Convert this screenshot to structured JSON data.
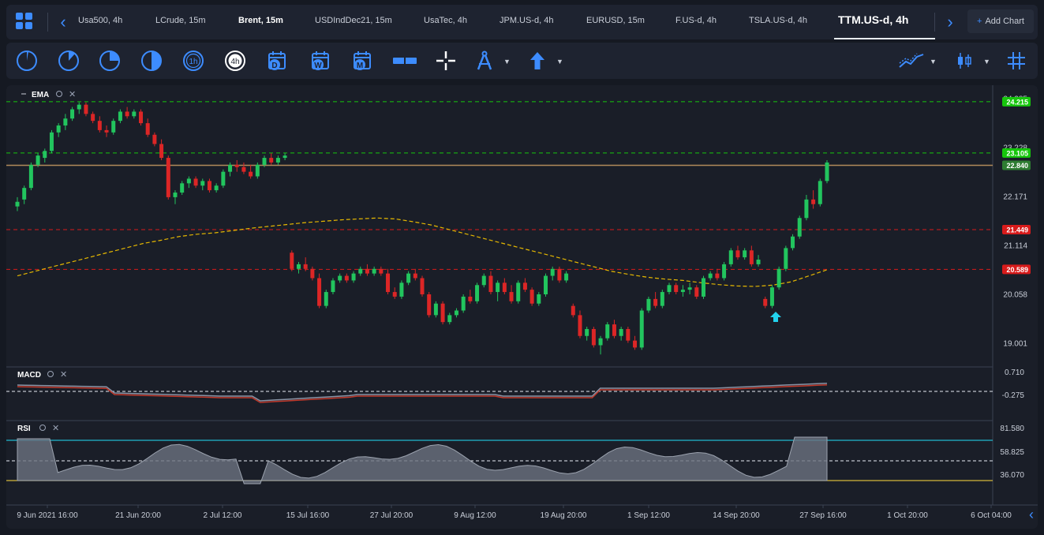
{
  "tabs": {
    "items": [
      {
        "label": "Usa500, 4h"
      },
      {
        "label": "LCrude, 15m"
      },
      {
        "label": "Brent, 15m"
      },
      {
        "label": "USDIndDec21, 15m"
      },
      {
        "label": "UsaTec, 4h"
      },
      {
        "label": "JPM.US-d, 4h"
      },
      {
        "label": "EURUSD, 15m"
      },
      {
        "label": "F.US-d, 4h"
      },
      {
        "label": "TSLA.US-d, 4h"
      },
      {
        "label": "TTM.US-d, 4h"
      }
    ],
    "active_index": 9,
    "add_chart_label": "Add Chart"
  },
  "toolbar": {
    "timeframes": [
      {
        "icon": "1m-timeframe-icon"
      },
      {
        "icon": "15m-timeframe-icon"
      },
      {
        "icon": "30m-timeframe-icon"
      },
      {
        "icon": "2h-timeframe-icon"
      },
      {
        "label": "1h"
      },
      {
        "label": "4h",
        "active": true
      },
      {
        "label": "D"
      },
      {
        "label": "W"
      },
      {
        "label": "M"
      }
    ],
    "tools": [
      "horizontal-line-icon",
      "crosshair-icon",
      "drawing-compass-icon",
      "arrow-up-icon"
    ],
    "right_tools": [
      "trend-indicator-icon",
      "candlestick-type-icon",
      "grid-icon"
    ]
  },
  "main_panel": {
    "indicator_label": "EMA",
    "price_labels": [
      {
        "text": "24.285",
        "kind": "axis"
      },
      {
        "text": "24.215",
        "kind": "badge",
        "color": "#16c60c"
      },
      {
        "text": "23.228",
        "kind": "axis"
      },
      {
        "text": "23.105",
        "kind": "badge",
        "color": "#16c60c"
      },
      {
        "text": "22.840",
        "kind": "badge",
        "color": "#2e7d32"
      },
      {
        "text": "22.171",
        "kind": "axis"
      },
      {
        "text": "21.449",
        "kind": "badge",
        "color": "#d81b1b"
      },
      {
        "text": "21.114",
        "kind": "axis"
      },
      {
        "text": "20.589",
        "kind": "badge",
        "color": "#d81b1b"
      },
      {
        "text": "20.058",
        "kind": "axis"
      },
      {
        "text": "19.001",
        "kind": "axis"
      }
    ]
  },
  "macd_panel": {
    "label": "MACD",
    "axis_labels": [
      "0.710",
      "-0.275"
    ]
  },
  "rsi_panel": {
    "label": "RSI",
    "axis_labels": [
      "81.580",
      "58.825",
      "36.070"
    ]
  },
  "time_axis": [
    "9 Jun 2021 16:00",
    "21 Jun 20:00",
    "2 Jul 12:00",
    "15 Jul 16:00",
    "27 Jul 20:00",
    "9 Aug 12:00",
    "19 Aug 20:00",
    "1 Sep 12:00",
    "14 Sep 20:00",
    "27 Sep 16:00",
    "1 Oct 20:00",
    "6 Oct 04:00"
  ],
  "colors": {
    "up": "#22c55e",
    "down": "#dc2626",
    "accent": "#3d8cff",
    "ema": "#e6b800",
    "resistance": "#16c60c",
    "support": "#d81b1b",
    "rsi_upper": "#22b8cf",
    "rsi_lower": "#d4b83a"
  },
  "chart_data": {
    "type": "candlestick",
    "series": [
      {
        "name": "TTM.US-d, 4h"
      }
    ],
    "candles": [
      [
        21.95,
        22.15,
        21.85,
        22.05
      ],
      [
        22.1,
        22.4,
        22.0,
        22.35
      ],
      [
        22.35,
        22.9,
        22.3,
        22.85
      ],
      [
        22.85,
        23.1,
        22.8,
        23.05
      ],
      [
        23.0,
        23.2,
        22.9,
        23.15
      ],
      [
        23.15,
        23.6,
        23.1,
        23.55
      ],
      [
        23.55,
        23.75,
        23.45,
        23.7
      ],
      [
        23.7,
        23.95,
        23.6,
        23.85
      ],
      [
        23.85,
        24.1,
        23.8,
        24.05
      ],
      [
        24.05,
        24.2,
        23.95,
        24.15
      ],
      [
        24.15,
        24.2,
        23.9,
        23.95
      ],
      [
        23.95,
        24.0,
        23.75,
        23.8
      ],
      [
        23.8,
        23.9,
        23.55,
        23.6
      ],
      [
        23.6,
        23.7,
        23.45,
        23.55
      ],
      [
        23.55,
        23.85,
        23.5,
        23.8
      ],
      [
        23.8,
        24.05,
        23.75,
        24.0
      ],
      [
        24.0,
        24.1,
        23.85,
        23.9
      ],
      [
        23.9,
        24.05,
        23.85,
        24.0
      ],
      [
        24.0,
        24.05,
        23.7,
        23.75
      ],
      [
        23.75,
        23.85,
        23.45,
        23.5
      ],
      [
        23.5,
        23.55,
        23.25,
        23.3
      ],
      [
        23.3,
        23.4,
        22.95,
        23.0
      ],
      [
        23.0,
        23.05,
        22.1,
        22.15
      ],
      [
        22.15,
        22.3,
        22.0,
        22.25
      ],
      [
        22.25,
        22.5,
        22.2,
        22.45
      ],
      [
        22.45,
        22.6,
        22.35,
        22.55
      ],
      [
        22.55,
        22.6,
        22.35,
        22.4
      ],
      [
        22.4,
        22.55,
        22.3,
        22.5
      ],
      [
        22.5,
        22.55,
        22.25,
        22.3
      ],
      [
        22.3,
        22.45,
        22.25,
        22.4
      ],
      [
        22.4,
        22.75,
        22.35,
        22.7
      ],
      [
        22.7,
        22.9,
        22.6,
        22.85
      ],
      [
        22.85,
        22.95,
        22.7,
        22.8
      ],
      [
        22.8,
        22.9,
        22.65,
        22.7
      ],
      [
        22.7,
        22.85,
        22.55,
        22.6
      ],
      [
        22.6,
        22.9,
        22.55,
        22.85
      ],
      [
        22.85,
        23.05,
        22.8,
        23.0
      ],
      [
        23.0,
        23.1,
        22.85,
        22.9
      ],
      [
        22.9,
        23.05,
        22.85,
        23.0
      ],
      [
        23.0,
        23.1,
        22.95,
        23.05
      ],
      [
        20.95,
        21.0,
        20.55,
        20.6
      ],
      [
        20.6,
        20.75,
        20.5,
        20.7
      ],
      [
        20.7,
        20.85,
        20.55,
        20.6
      ],
      [
        20.6,
        20.65,
        20.35,
        20.4
      ],
      [
        20.4,
        20.5,
        19.75,
        19.8
      ],
      [
        19.8,
        20.15,
        19.75,
        20.1
      ],
      [
        20.1,
        20.4,
        20.05,
        20.35
      ],
      [
        20.35,
        20.5,
        20.3,
        20.45
      ],
      [
        20.45,
        20.5,
        20.3,
        20.35
      ],
      [
        20.35,
        20.55,
        20.3,
        20.5
      ],
      [
        20.5,
        20.65,
        20.45,
        20.6
      ],
      [
        20.6,
        20.7,
        20.45,
        20.5
      ],
      [
        20.5,
        20.65,
        20.45,
        20.6
      ],
      [
        20.6,
        20.65,
        20.45,
        20.5
      ],
      [
        20.5,
        20.6,
        20.05,
        20.1
      ],
      [
        20.1,
        20.2,
        19.95,
        20.0
      ],
      [
        20.0,
        20.35,
        19.95,
        20.3
      ],
      [
        20.3,
        20.55,
        20.25,
        20.5
      ],
      [
        20.5,
        20.6,
        20.35,
        20.4
      ],
      [
        20.4,
        20.45,
        20.0,
        20.05
      ],
      [
        20.05,
        20.1,
        19.55,
        19.6
      ],
      [
        19.6,
        19.9,
        19.55,
        19.85
      ],
      [
        19.85,
        19.9,
        19.4,
        19.45
      ],
      [
        19.45,
        19.65,
        19.4,
        19.6
      ],
      [
        19.6,
        19.75,
        19.55,
        19.7
      ],
      [
        19.7,
        20.05,
        19.65,
        20.0
      ],
      [
        20.0,
        20.15,
        19.85,
        19.9
      ],
      [
        19.9,
        20.3,
        19.85,
        20.25
      ],
      [
        20.25,
        20.5,
        20.2,
        20.45
      ],
      [
        20.45,
        20.55,
        20.05,
        20.1
      ],
      [
        20.1,
        20.35,
        19.9,
        20.3
      ],
      [
        20.3,
        20.4,
        20.05,
        20.1
      ],
      [
        20.1,
        20.25,
        19.85,
        19.9
      ],
      [
        19.9,
        20.35,
        19.85,
        20.3
      ],
      [
        20.3,
        20.4,
        20.1,
        20.15
      ],
      [
        20.15,
        20.2,
        19.8,
        19.85
      ],
      [
        19.85,
        20.1,
        19.8,
        20.05
      ],
      [
        20.05,
        20.5,
        20.0,
        20.45
      ],
      [
        20.45,
        20.65,
        20.35,
        20.6
      ],
      [
        20.6,
        20.65,
        20.3,
        20.35
      ],
      [
        20.35,
        20.55,
        20.3,
        20.5
      ],
      [
        19.8,
        19.85,
        19.55,
        19.6
      ],
      [
        19.6,
        19.7,
        19.1,
        19.15
      ],
      [
        19.15,
        19.35,
        19.05,
        19.3
      ],
      [
        19.3,
        19.35,
        18.9,
        18.95
      ],
      [
        18.95,
        19.15,
        18.75,
        19.1
      ],
      [
        19.1,
        19.45,
        19.05,
        19.4
      ],
      [
        19.4,
        19.5,
        19.1,
        19.15
      ],
      [
        19.15,
        19.35,
        19.05,
        19.3
      ],
      [
        19.3,
        19.35,
        19.0,
        19.05
      ],
      [
        19.05,
        19.15,
        18.85,
        18.9
      ],
      [
        18.9,
        19.75,
        18.85,
        19.7
      ],
      [
        19.7,
        20.0,
        19.65,
        19.95
      ],
      [
        19.95,
        20.1,
        19.75,
        19.8
      ],
      [
        19.8,
        20.15,
        19.75,
        20.1
      ],
      [
        20.1,
        20.3,
        20.05,
        20.25
      ],
      [
        20.25,
        20.3,
        20.05,
        20.1
      ],
      [
        20.1,
        20.25,
        20.0,
        20.15
      ],
      [
        20.15,
        20.3,
        20.05,
        20.2
      ],
      [
        20.2,
        20.25,
        19.95,
        20.0
      ],
      [
        20.0,
        20.45,
        19.95,
        20.4
      ],
      [
        20.4,
        20.55,
        20.35,
        20.5
      ],
      [
        20.5,
        20.6,
        20.35,
        20.4
      ],
      [
        20.4,
        20.75,
        20.35,
        20.7
      ],
      [
        20.7,
        21.05,
        20.65,
        21.0
      ],
      [
        21.0,
        21.1,
        20.8,
        20.85
      ],
      [
        20.85,
        21.05,
        20.8,
        21.0
      ],
      [
        21.0,
        21.1,
        20.65,
        20.7
      ],
      [
        20.7,
        20.9,
        20.65,
        20.8
      ],
      [
        19.95,
        20.0,
        19.75,
        19.8
      ],
      [
        19.8,
        20.25,
        19.75,
        20.2
      ],
      [
        20.2,
        20.65,
        20.15,
        20.6
      ],
      [
        20.6,
        21.1,
        20.55,
        21.05
      ],
      [
        21.05,
        21.35,
        21.0,
        21.3
      ],
      [
        21.3,
        21.75,
        21.25,
        21.7
      ],
      [
        21.7,
        22.2,
        21.65,
        22.1
      ],
      [
        22.1,
        22.3,
        21.9,
        22.0
      ],
      [
        22.0,
        22.55,
        21.95,
        22.5
      ],
      [
        22.5,
        22.95,
        22.45,
        22.9
      ]
    ],
    "ema": [
      20.45,
      20.55,
      20.65,
      20.75,
      20.85,
      20.95,
      21.05,
      21.15,
      21.22,
      21.3,
      21.35,
      21.38,
      21.43,
      21.48,
      21.52,
      21.56,
      21.6,
      21.63,
      21.66,
      21.68,
      21.7,
      21.68,
      21.62,
      21.55,
      21.45,
      21.35,
      21.25,
      21.15,
      21.05,
      20.95,
      20.85,
      20.75,
      20.65,
      20.55,
      20.48,
      20.42,
      20.38,
      20.35,
      20.3,
      20.26,
      20.23,
      20.22,
      20.25,
      20.32,
      20.45,
      20.58
    ],
    "ylim": [
      18.6,
      24.4
    ]
  }
}
